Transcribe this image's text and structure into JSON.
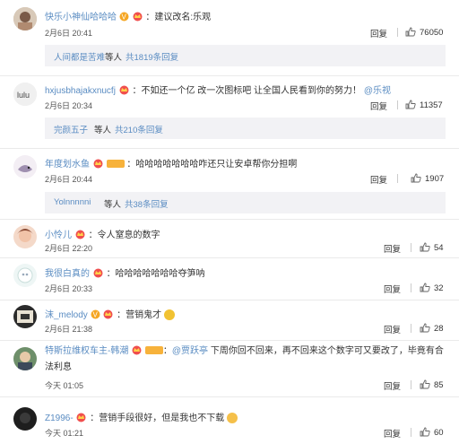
{
  "comments": [
    {
      "user": "快乐小神仙哈哈哈",
      "text": "：建议改名:乐观",
      "time": "2月6日 20:41",
      "reply": "回复",
      "likes": "76050"
    },
    {
      "user": "hxjusbhajakxnucfj",
      "text": "：不如还一个亿 改一次图标吧 让全国人民看到你的努力！",
      "mention": "@乐视",
      "time": "2月6日 20:34",
      "reply": "回复",
      "likes": "11357"
    },
    {
      "user": "年度划水鱼",
      "text": "：哈哈哈哈哈哈哈咋还只让安卓帮你分担啊",
      "time": "2月6日 20:44",
      "reply": "回复",
      "likes": "1907"
    },
    {
      "user": "小怜儿",
      "text": "：令人窒息的数字",
      "time": "2月6日 22:20",
      "reply": "回复",
      "likes": "54"
    },
    {
      "user": "我很白真的",
      "text": "：哈哈哈哈哈哈哈夺笋呐",
      "time": "2月6日 20:33",
      "reply": "回复",
      "likes": "32"
    },
    {
      "user": "沫_melody",
      "text": "：营销鬼才",
      "time": "2月6日 21:38",
      "reply": "回复",
      "likes": "28"
    },
    {
      "user": "特斯拉维权车主-韩潮",
      "mention": "@贾跃亭",
      "text": " 下周你回不回来，再不回来这个数字可又要改了，毕竟有合法利息",
      "time": "今天 01:05",
      "reply": "回复",
      "likes": "85"
    },
    {
      "user": "Z1996-",
      "text": "：营销手段很好，但是我也不下载",
      "time": "今天 01:21",
      "reply": "回复",
      "likes": "60"
    }
  ],
  "subreplies": [
    {
      "user": "人间都是苦难",
      "suffix": "等人",
      "count": "共1819条回复"
    },
    {
      "user": "完颜五子",
      "suffix": "等人",
      "count": "共210条回复"
    },
    {
      "user": "Yolnnnnni",
      "suffix": "等人",
      "count": "共38条回复"
    }
  ],
  "colors": {
    "name": "#eb7350",
    "link": "#5a8cc2",
    "bg_sub": "#f2f2f5"
  },
  "icons": {
    "like": "thumb-up-icon",
    "verified": "verified-v-icon",
    "vip": "vip-crown-icon"
  }
}
